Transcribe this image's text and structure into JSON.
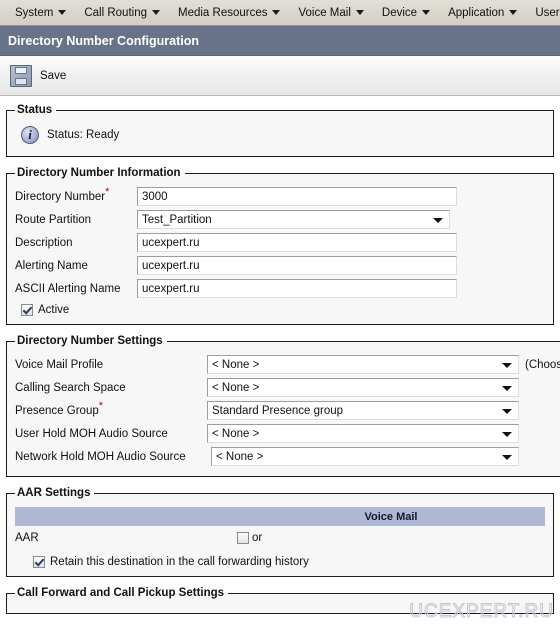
{
  "menubar": {
    "items": [
      {
        "label": "System",
        "caret": true
      },
      {
        "label": "Call Routing",
        "caret": true
      },
      {
        "label": "Media Resources",
        "caret": true
      },
      {
        "label": "Voice Mail",
        "caret": true
      },
      {
        "label": "Device",
        "caret": true
      },
      {
        "label": "Application",
        "caret": true
      },
      {
        "label": "User Management",
        "caret": true
      }
    ]
  },
  "header": {
    "title": "Directory Number Configuration"
  },
  "toolbar": {
    "save_label": "Save"
  },
  "status_section": {
    "legend": "Status",
    "status_text": "Status: Ready"
  },
  "dn_information": {
    "legend": "Directory Number Information",
    "fields": {
      "directory_number_label": "Directory Number",
      "directory_number_value": "3000",
      "route_partition_label": "Route Partition",
      "route_partition_value": "Test_Partition",
      "description_label": "Description",
      "description_value": "ucexpert.ru",
      "alerting_name_label": "Alerting Name",
      "alerting_name_value": "ucexpert.ru",
      "ascii_alerting_name_label": "ASCII Alerting Name",
      "ascii_alerting_name_value": "ucexpert.ru",
      "active_label": "Active"
    }
  },
  "dn_settings": {
    "legend": "Directory Number Settings",
    "rows": [
      {
        "label": "Voice Mail Profile",
        "value": "< None >",
        "hint": "(Choose"
      },
      {
        "label": "Calling Search Space",
        "value": "< None >",
        "hint": ""
      },
      {
        "label": "Presence Group",
        "value": "Standard Presence group",
        "hint": ""
      },
      {
        "label": "User Hold MOH Audio Source",
        "value": "< None >",
        "hint": ""
      },
      {
        "label": "Network Hold MOH Audio Source",
        "value": "< None >",
        "hint": ""
      }
    ]
  },
  "aar_settings": {
    "legend": "AAR Settings",
    "table": {
      "headers": [
        "",
        "Voice Mail"
      ],
      "row_label": "AAR",
      "or_label": "or"
    },
    "retain_label": "Retain this destination in the call forwarding history"
  },
  "call_forward_section": {
    "legend": "Call Forward and Call Pickup Settings"
  },
  "watermark": {
    "text": "UCEXPERT.RU"
  },
  "colors": {
    "title_bar": "#687288",
    "menu_bar": "#d4d0c8",
    "table_header": "#aeb8d4",
    "required_asterisk": "#c40000"
  }
}
